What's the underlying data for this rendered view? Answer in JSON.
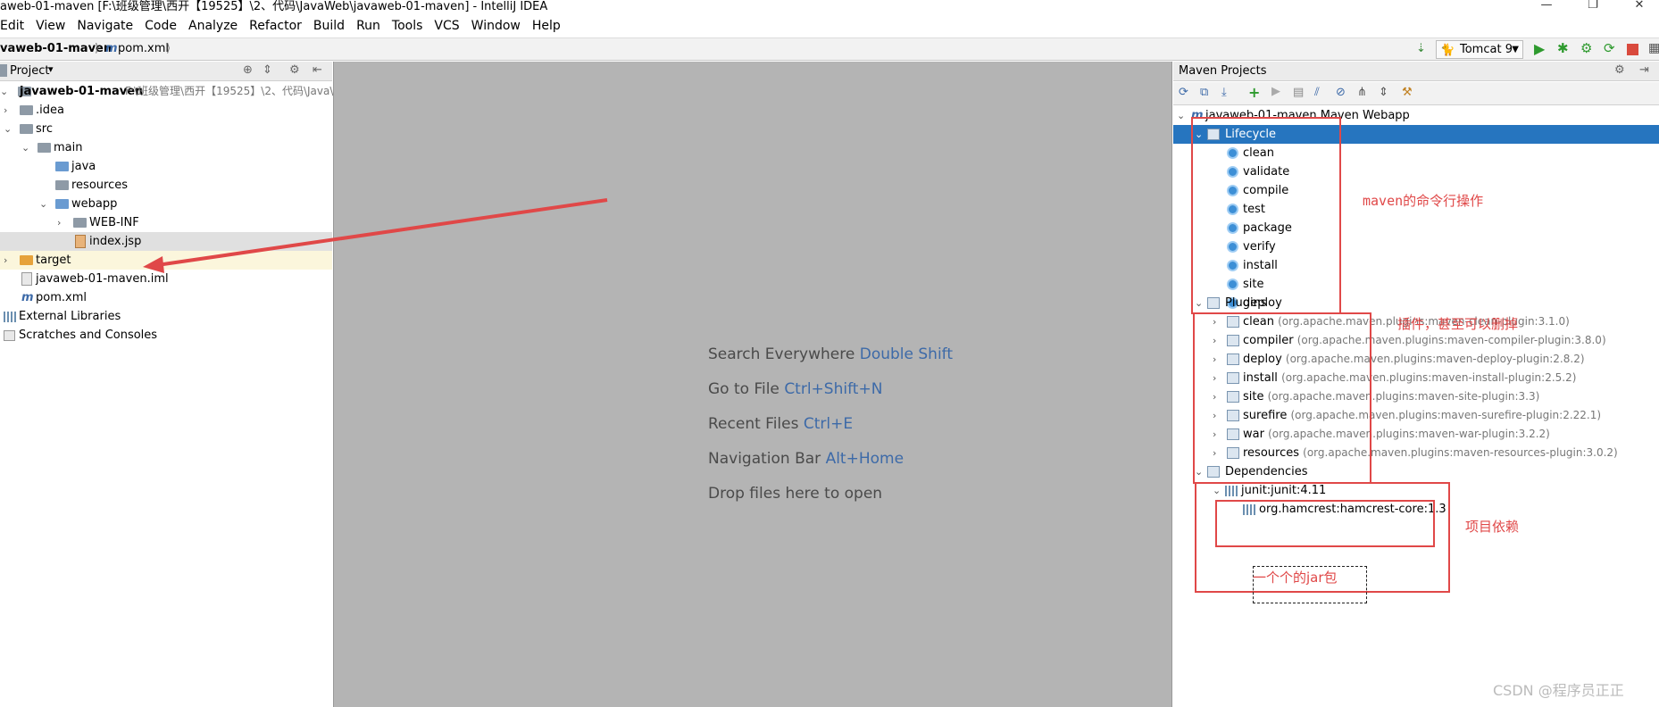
{
  "window": {
    "title": "aweb-01-maven [F:\\班级管理\\西开【19525】\\2、代码\\JavaWeb\\javaweb-01-maven] - IntelliJ IDEA",
    "controls": [
      "—",
      "❐",
      "✕"
    ]
  },
  "menu": [
    "Edit",
    "View",
    "Navigate",
    "Code",
    "Analyze",
    "Refactor",
    "Build",
    "Run",
    "Tools",
    "VCS",
    "Window",
    "Help"
  ],
  "breadcrumb": {
    "project": "vaweb-01-maven",
    "file": "pom.xml"
  },
  "run_config": {
    "label": "Tomcat 9"
  },
  "project_panel": {
    "header": "Project",
    "root_name": "javaweb-01-maven",
    "root_path": "F:\\班级管理\\西开【19525】\\2、代码\\Java\\",
    "items": [
      {
        "label": ".idea"
      },
      {
        "label": "src"
      },
      {
        "label": "main"
      },
      {
        "label": "java"
      },
      {
        "label": "resources"
      },
      {
        "label": "webapp"
      },
      {
        "label": "WEB-INF"
      },
      {
        "label": "index.jsp"
      },
      {
        "label": "target"
      },
      {
        "label": "javaweb-01-maven.iml"
      },
      {
        "label": "pom.xml"
      },
      {
        "label": "External Libraries"
      },
      {
        "label": "Scratches and Consoles"
      }
    ]
  },
  "editor_hints": [
    {
      "text": "Search Everywhere",
      "key": "Double Shift"
    },
    {
      "text": "Go to File",
      "key": "Ctrl+Shift+N"
    },
    {
      "text": "Recent Files",
      "key": "Ctrl+E"
    },
    {
      "text": "Navigation Bar",
      "key": "Alt+Home"
    },
    {
      "text": "Drop files here to open",
      "key": ""
    }
  ],
  "maven_panel": {
    "header": "Maven Projects",
    "project": "javaweb-01-maven Maven Webapp",
    "lifecycle_label": "Lifecycle",
    "lifecycle": [
      "clean",
      "validate",
      "compile",
      "test",
      "package",
      "verify",
      "install",
      "site",
      "deploy"
    ],
    "plugins_label": "Plugins",
    "plugins": [
      {
        "name": "clean",
        "detail": "(org.apache.maven.plugins:maven-clean-plugin:3.1.0)"
      },
      {
        "name": "compiler",
        "detail": "(org.apache.maven.plugins:maven-compiler-plugin:3.8.0)"
      },
      {
        "name": "deploy",
        "detail": "(org.apache.maven.plugins:maven-deploy-plugin:2.8.2)"
      },
      {
        "name": "install",
        "detail": "(org.apache.maven.plugins:maven-install-plugin:2.5.2)"
      },
      {
        "name": "site",
        "detail": "(org.apache.maven.plugins:maven-site-plugin:3.3)"
      },
      {
        "name": "surefire",
        "detail": "(org.apache.maven.plugins:maven-surefire-plugin:2.22.1)"
      },
      {
        "name": "war",
        "detail": "(org.apache.maven.plugins:maven-war-plugin:3.2.2)"
      },
      {
        "name": "resources",
        "detail": "(org.apache.maven.plugins:maven-resources-plugin:3.0.2)"
      }
    ],
    "dependencies_label": "Dependencies",
    "dependencies": [
      "junit:junit:4.11",
      "org.hamcrest:hamcrest-core:1.3"
    ]
  },
  "annotations": {
    "lifecycle_note": "maven的命令行操作",
    "plugins_note": "插件，甚至可以删掉",
    "deps_note": "项目依赖",
    "jar_note": "一个个的jar包",
    "watermark": "CSDN @程序员正正"
  },
  "colors": {
    "selection": "#2675bf",
    "annotation": "#e04848",
    "editor_bg": "#b4b4b4"
  }
}
